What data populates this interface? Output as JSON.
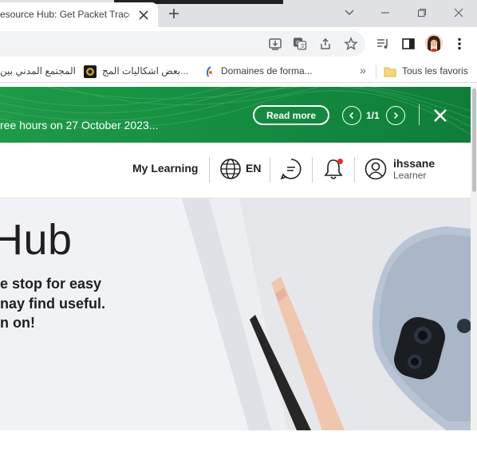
{
  "browser": {
    "tab_title": "esource Hub: Get Packet Tracer",
    "bookmarks": [
      {
        "label": "المجتمع المدني بين"
      },
      {
        "label": "بعض اشكاليات المج..."
      },
      {
        "label": "Domaines de forma..."
      },
      {
        "label": "»"
      },
      {
        "label": "Tous les favoris"
      }
    ]
  },
  "banner": {
    "text": "ree hours on 27 October 2023...",
    "read_more": "Read more",
    "pager": "1/1"
  },
  "header": {
    "my_learning": "My Learning",
    "language": "EN",
    "user_name": "ihssane",
    "user_role": "Learner"
  },
  "hero": {
    "title": "Hub",
    "lines": [
      "e stop for easy",
      "nay find useful.",
      "n on!"
    ]
  },
  "colors": {
    "banner_green": "#138a3f",
    "notification_dot": "#e0322b"
  }
}
